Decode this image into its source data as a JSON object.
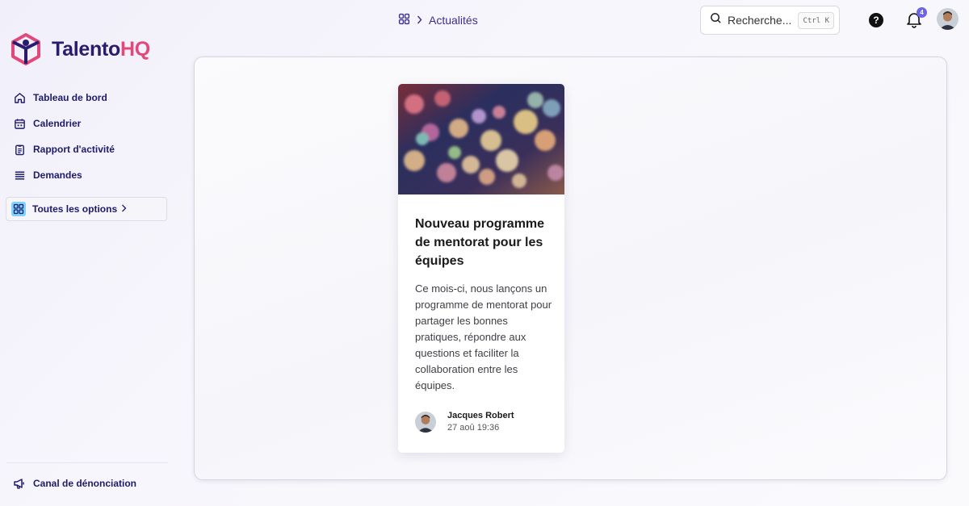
{
  "brand": {
    "name_part1": "Talento",
    "name_part2": "HQ",
    "primary_color": "#2a1b6e",
    "accent_color": "#e2487a"
  },
  "sidebar": {
    "items": [
      {
        "label": "Tableau de bord",
        "icon": "home-icon"
      },
      {
        "label": "Calendrier",
        "icon": "calendar-icon"
      },
      {
        "label": "Rapport d'activité",
        "icon": "clipboard-icon"
      },
      {
        "label": "Demandes",
        "icon": "list-icon"
      }
    ],
    "all_options": {
      "label": "Toutes les options",
      "icon": "grid-icon"
    },
    "report_channel": {
      "label": "Canal de dénonciation",
      "icon": "megaphone-icon"
    }
  },
  "header": {
    "breadcrumb": {
      "current": "Actualités"
    },
    "search": {
      "placeholder": "Recherche...",
      "shortcut": "Ctrl K"
    },
    "notifications": {
      "count": "4"
    },
    "help": {
      "label": "?"
    }
  },
  "news_card": {
    "title": "Nouveau programme de mentorat pour les équipes",
    "body": "Ce mois-ci, nous lançons un programme de mentorat pour partager les bonnes pratiques, répondre aux questions et faciliter la collaboration entre les équipes.",
    "author": "Jacques Robert",
    "date": "27 aoû 19:36"
  }
}
